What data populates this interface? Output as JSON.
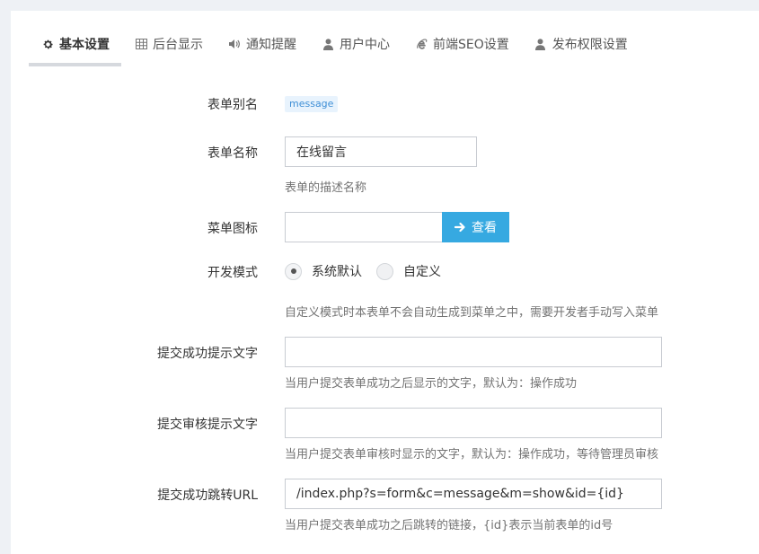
{
  "tabs": [
    {
      "label": "基本设置",
      "icon": "gear-icon"
    },
    {
      "label": "后台显示",
      "icon": "table-icon"
    },
    {
      "label": "通知提醒",
      "icon": "volume-icon"
    },
    {
      "label": "用户中心",
      "icon": "user-icon"
    },
    {
      "label": "前端SEO设置",
      "icon": "internet-explorer-icon"
    },
    {
      "label": "发布权限设置",
      "icon": "user-icon"
    }
  ],
  "form": {
    "alias": {
      "label": "表单别名",
      "value": "message"
    },
    "name": {
      "label": "表单名称",
      "value": "在线留言",
      "help": "表单的描述名称"
    },
    "menu_icon": {
      "label": "菜单图标",
      "value": "",
      "button": "查看"
    },
    "dev_mode": {
      "label": "开发模式",
      "options": [
        "系统默认",
        "自定义"
      ],
      "selected": "系统默认",
      "help": "自定义模式时本表单不会自动生成到菜单之中，需要开发者手动写入菜单"
    },
    "success_text": {
      "label": "提交成功提示文字",
      "value": "",
      "help": "当用户提交表单成功之后显示的文字，默认为：操作成功"
    },
    "review_text": {
      "label": "提交审核提示文字",
      "value": "",
      "help": "当用户提交表单审核时显示的文字，默认为：操作成功，等待管理员审核"
    },
    "redirect_url": {
      "label": "提交成功跳转URL",
      "value": "/index.php?s=form&c=message&m=show&id={id}",
      "help": "当用户提交表单成功之后跳转的链接，{id}表示当前表单的id号"
    }
  },
  "colors": {
    "accent": "#36a9e1",
    "badge_text": "#3f8fd6",
    "badge_bg": "#e8f3fd"
  }
}
